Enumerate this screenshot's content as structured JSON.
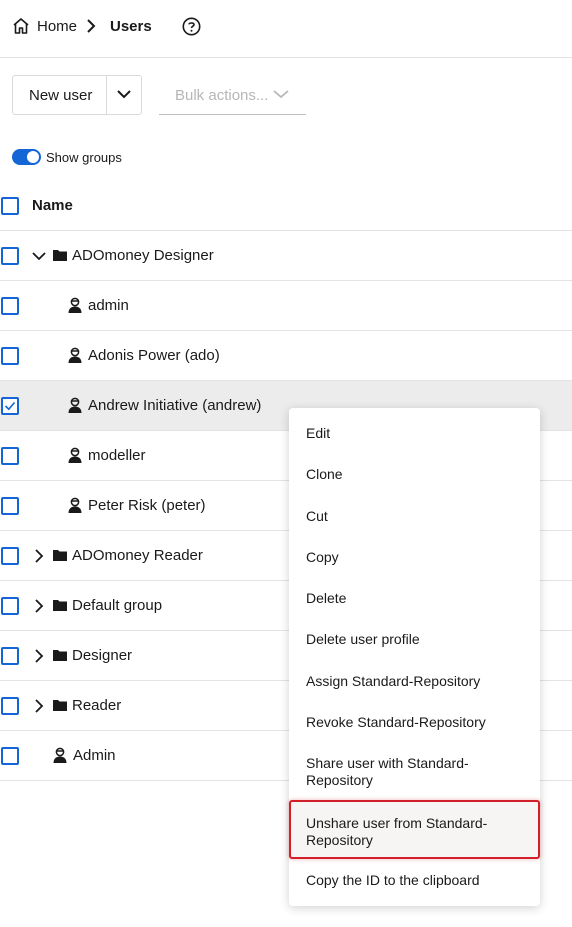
{
  "breadcrumb": {
    "home": "Home",
    "current": "Users"
  },
  "toolbar": {
    "new_user": "New user",
    "bulk_actions": "Bulk actions..."
  },
  "toggle": {
    "label": "Show groups",
    "on": true
  },
  "table": {
    "header": "Name",
    "rows": [
      {
        "label": "ADOmoney Designer",
        "kind": "group",
        "expanded": true,
        "checked": false
      },
      {
        "label": "admin",
        "kind": "user",
        "checked": false
      },
      {
        "label": "Adonis Power (ado)",
        "kind": "user",
        "checked": false
      },
      {
        "label": "Andrew Initiative (andrew)",
        "kind": "user",
        "checked": true
      },
      {
        "label": "modeller",
        "kind": "user",
        "checked": false
      },
      {
        "label": "Peter Risk (peter)",
        "kind": "user",
        "checked": false
      },
      {
        "label": "ADOmoney Reader",
        "kind": "group",
        "expanded": false,
        "checked": false
      },
      {
        "label": "Default group",
        "kind": "group",
        "expanded": false,
        "checked": false
      },
      {
        "label": "Designer",
        "kind": "group",
        "expanded": false,
        "checked": false
      },
      {
        "label": "Reader",
        "kind": "group",
        "expanded": false,
        "checked": false
      },
      {
        "label": "Admin",
        "kind": "user",
        "checked": false
      }
    ]
  },
  "context_menu": {
    "items": [
      "Edit",
      "Clone",
      "Cut",
      "Copy",
      "Delete",
      "Delete user profile",
      "Assign Standard-Repository",
      "Revoke Standard-Repository",
      "Share user with Standard-Repository",
      "Unshare user from Standard-Repository",
      "Copy the ID to the clipboard"
    ],
    "highlighted": "Unshare user from Standard-Repository"
  },
  "colors": {
    "accent": "#1466d6",
    "highlight_border": "#d21f2a",
    "selected_row": "#ececec"
  }
}
